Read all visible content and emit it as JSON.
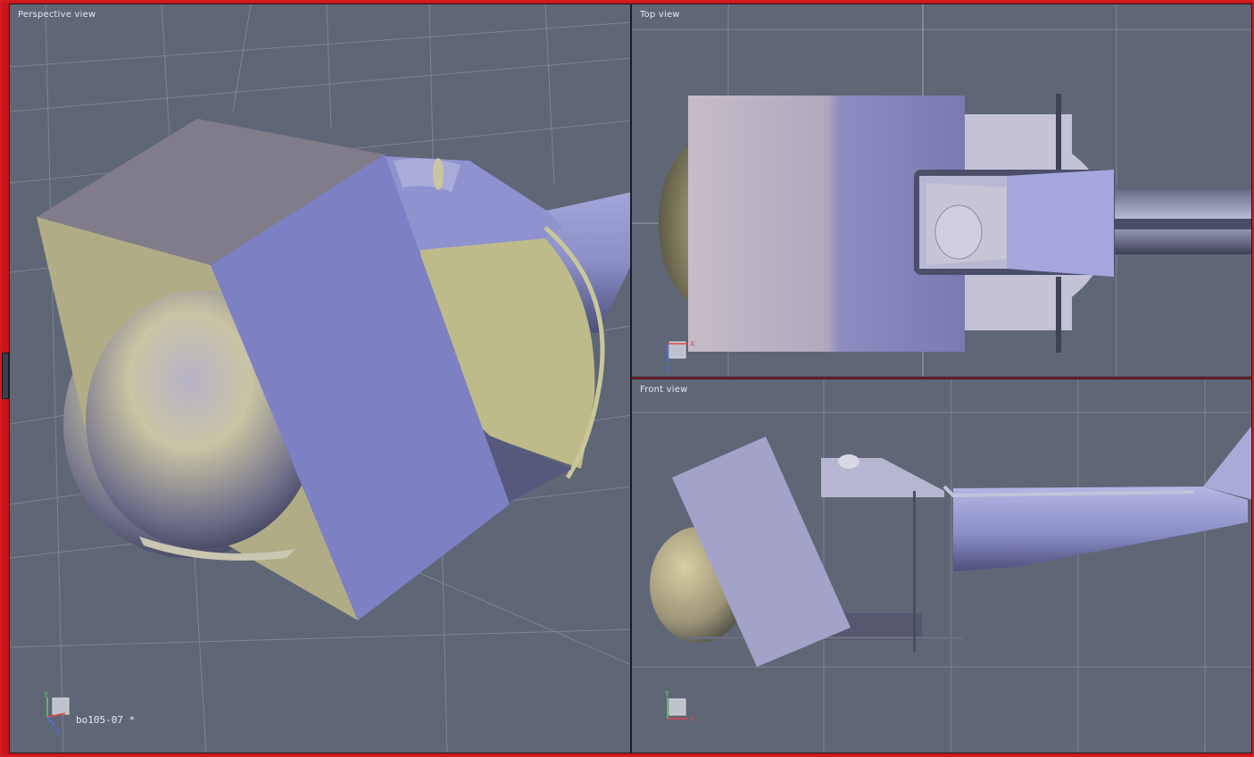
{
  "viewports": {
    "perspective": {
      "title": "Perspective view"
    },
    "top": {
      "title": "Top view"
    },
    "front": {
      "title": "Front view"
    }
  },
  "scene": {
    "name": "bo105-07 *"
  },
  "axes": {
    "perspective": {
      "a": "Y",
      "b": "Z"
    },
    "top": {
      "a": "X",
      "b": "Z"
    },
    "front": {
      "a": "Y",
      "b": "X"
    }
  },
  "colors": {
    "viewport_bg": "#5f6676",
    "grid": "#7c8393",
    "window_border": "#d51a22"
  }
}
